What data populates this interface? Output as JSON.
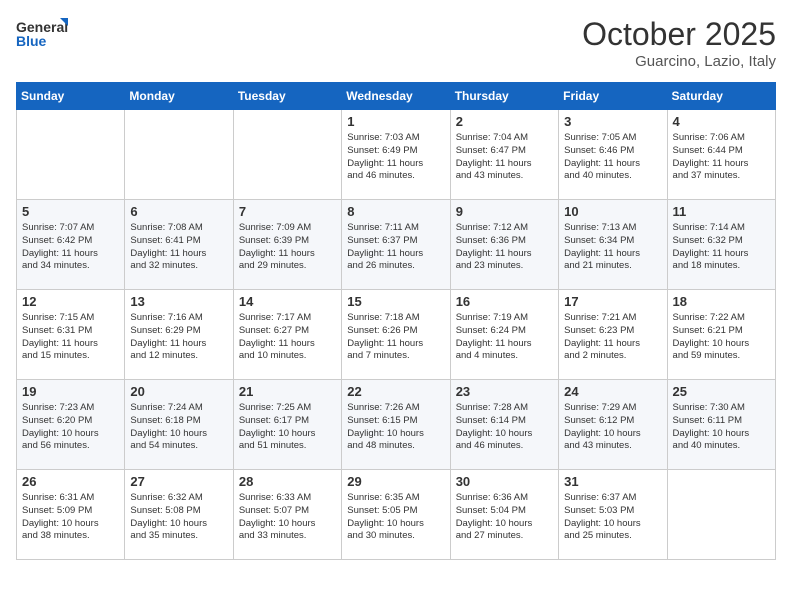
{
  "header": {
    "logo_general": "General",
    "logo_blue": "Blue",
    "title": "October 2025",
    "subtitle": "Guarcino, Lazio, Italy"
  },
  "weekdays": [
    "Sunday",
    "Monday",
    "Tuesday",
    "Wednesday",
    "Thursday",
    "Friday",
    "Saturday"
  ],
  "weeks": [
    [
      {
        "day": "",
        "info": ""
      },
      {
        "day": "",
        "info": ""
      },
      {
        "day": "",
        "info": ""
      },
      {
        "day": "1",
        "info": "Sunrise: 7:03 AM\nSunset: 6:49 PM\nDaylight: 11 hours\nand 46 minutes."
      },
      {
        "day": "2",
        "info": "Sunrise: 7:04 AM\nSunset: 6:47 PM\nDaylight: 11 hours\nand 43 minutes."
      },
      {
        "day": "3",
        "info": "Sunrise: 7:05 AM\nSunset: 6:46 PM\nDaylight: 11 hours\nand 40 minutes."
      },
      {
        "day": "4",
        "info": "Sunrise: 7:06 AM\nSunset: 6:44 PM\nDaylight: 11 hours\nand 37 minutes."
      }
    ],
    [
      {
        "day": "5",
        "info": "Sunrise: 7:07 AM\nSunset: 6:42 PM\nDaylight: 11 hours\nand 34 minutes."
      },
      {
        "day": "6",
        "info": "Sunrise: 7:08 AM\nSunset: 6:41 PM\nDaylight: 11 hours\nand 32 minutes."
      },
      {
        "day": "7",
        "info": "Sunrise: 7:09 AM\nSunset: 6:39 PM\nDaylight: 11 hours\nand 29 minutes."
      },
      {
        "day": "8",
        "info": "Sunrise: 7:11 AM\nSunset: 6:37 PM\nDaylight: 11 hours\nand 26 minutes."
      },
      {
        "day": "9",
        "info": "Sunrise: 7:12 AM\nSunset: 6:36 PM\nDaylight: 11 hours\nand 23 minutes."
      },
      {
        "day": "10",
        "info": "Sunrise: 7:13 AM\nSunset: 6:34 PM\nDaylight: 11 hours\nand 21 minutes."
      },
      {
        "day": "11",
        "info": "Sunrise: 7:14 AM\nSunset: 6:32 PM\nDaylight: 11 hours\nand 18 minutes."
      }
    ],
    [
      {
        "day": "12",
        "info": "Sunrise: 7:15 AM\nSunset: 6:31 PM\nDaylight: 11 hours\nand 15 minutes."
      },
      {
        "day": "13",
        "info": "Sunrise: 7:16 AM\nSunset: 6:29 PM\nDaylight: 11 hours\nand 12 minutes."
      },
      {
        "day": "14",
        "info": "Sunrise: 7:17 AM\nSunset: 6:27 PM\nDaylight: 11 hours\nand 10 minutes."
      },
      {
        "day": "15",
        "info": "Sunrise: 7:18 AM\nSunset: 6:26 PM\nDaylight: 11 hours\nand 7 minutes."
      },
      {
        "day": "16",
        "info": "Sunrise: 7:19 AM\nSunset: 6:24 PM\nDaylight: 11 hours\nand 4 minutes."
      },
      {
        "day": "17",
        "info": "Sunrise: 7:21 AM\nSunset: 6:23 PM\nDaylight: 11 hours\nand 2 minutes."
      },
      {
        "day": "18",
        "info": "Sunrise: 7:22 AM\nSunset: 6:21 PM\nDaylight: 10 hours\nand 59 minutes."
      }
    ],
    [
      {
        "day": "19",
        "info": "Sunrise: 7:23 AM\nSunset: 6:20 PM\nDaylight: 10 hours\nand 56 minutes."
      },
      {
        "day": "20",
        "info": "Sunrise: 7:24 AM\nSunset: 6:18 PM\nDaylight: 10 hours\nand 54 minutes."
      },
      {
        "day": "21",
        "info": "Sunrise: 7:25 AM\nSunset: 6:17 PM\nDaylight: 10 hours\nand 51 minutes."
      },
      {
        "day": "22",
        "info": "Sunrise: 7:26 AM\nSunset: 6:15 PM\nDaylight: 10 hours\nand 48 minutes."
      },
      {
        "day": "23",
        "info": "Sunrise: 7:28 AM\nSunset: 6:14 PM\nDaylight: 10 hours\nand 46 minutes."
      },
      {
        "day": "24",
        "info": "Sunrise: 7:29 AM\nSunset: 6:12 PM\nDaylight: 10 hours\nand 43 minutes."
      },
      {
        "day": "25",
        "info": "Sunrise: 7:30 AM\nSunset: 6:11 PM\nDaylight: 10 hours\nand 40 minutes."
      }
    ],
    [
      {
        "day": "26",
        "info": "Sunrise: 6:31 AM\nSunset: 5:09 PM\nDaylight: 10 hours\nand 38 minutes."
      },
      {
        "day": "27",
        "info": "Sunrise: 6:32 AM\nSunset: 5:08 PM\nDaylight: 10 hours\nand 35 minutes."
      },
      {
        "day": "28",
        "info": "Sunrise: 6:33 AM\nSunset: 5:07 PM\nDaylight: 10 hours\nand 33 minutes."
      },
      {
        "day": "29",
        "info": "Sunrise: 6:35 AM\nSunset: 5:05 PM\nDaylight: 10 hours\nand 30 minutes."
      },
      {
        "day": "30",
        "info": "Sunrise: 6:36 AM\nSunset: 5:04 PM\nDaylight: 10 hours\nand 27 minutes."
      },
      {
        "day": "31",
        "info": "Sunrise: 6:37 AM\nSunset: 5:03 PM\nDaylight: 10 hours\nand 25 minutes."
      },
      {
        "day": "",
        "info": ""
      }
    ]
  ]
}
